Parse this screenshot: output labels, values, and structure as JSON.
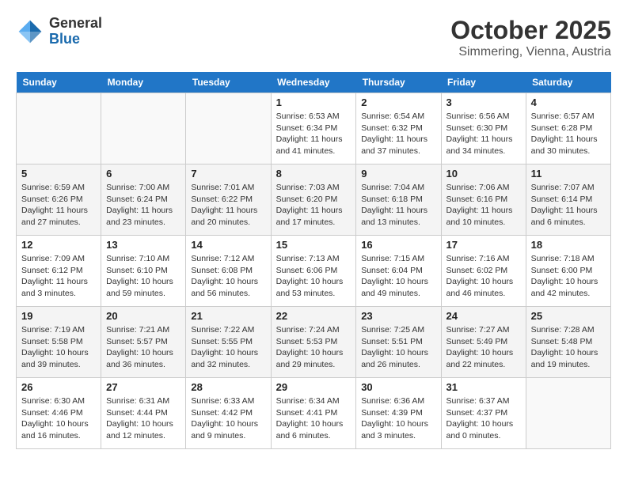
{
  "logo": {
    "general": "General",
    "blue": "Blue"
  },
  "header": {
    "month": "October 2025",
    "location": "Simmering, Vienna, Austria"
  },
  "weekdays": [
    "Sunday",
    "Monday",
    "Tuesday",
    "Wednesday",
    "Thursday",
    "Friday",
    "Saturday"
  ],
  "weeks": [
    [
      {
        "day": "",
        "info": ""
      },
      {
        "day": "",
        "info": ""
      },
      {
        "day": "",
        "info": ""
      },
      {
        "day": "1",
        "info": "Sunrise: 6:53 AM\nSunset: 6:34 PM\nDaylight: 11 hours\nand 41 minutes."
      },
      {
        "day": "2",
        "info": "Sunrise: 6:54 AM\nSunset: 6:32 PM\nDaylight: 11 hours\nand 37 minutes."
      },
      {
        "day": "3",
        "info": "Sunrise: 6:56 AM\nSunset: 6:30 PM\nDaylight: 11 hours\nand 34 minutes."
      },
      {
        "day": "4",
        "info": "Sunrise: 6:57 AM\nSunset: 6:28 PM\nDaylight: 11 hours\nand 30 minutes."
      }
    ],
    [
      {
        "day": "5",
        "info": "Sunrise: 6:59 AM\nSunset: 6:26 PM\nDaylight: 11 hours\nand 27 minutes."
      },
      {
        "day": "6",
        "info": "Sunrise: 7:00 AM\nSunset: 6:24 PM\nDaylight: 11 hours\nand 23 minutes."
      },
      {
        "day": "7",
        "info": "Sunrise: 7:01 AM\nSunset: 6:22 PM\nDaylight: 11 hours\nand 20 minutes."
      },
      {
        "day": "8",
        "info": "Sunrise: 7:03 AM\nSunset: 6:20 PM\nDaylight: 11 hours\nand 17 minutes."
      },
      {
        "day": "9",
        "info": "Sunrise: 7:04 AM\nSunset: 6:18 PM\nDaylight: 11 hours\nand 13 minutes."
      },
      {
        "day": "10",
        "info": "Sunrise: 7:06 AM\nSunset: 6:16 PM\nDaylight: 11 hours\nand 10 minutes."
      },
      {
        "day": "11",
        "info": "Sunrise: 7:07 AM\nSunset: 6:14 PM\nDaylight: 11 hours\nand 6 minutes."
      }
    ],
    [
      {
        "day": "12",
        "info": "Sunrise: 7:09 AM\nSunset: 6:12 PM\nDaylight: 11 hours\nand 3 minutes."
      },
      {
        "day": "13",
        "info": "Sunrise: 7:10 AM\nSunset: 6:10 PM\nDaylight: 10 hours\nand 59 minutes."
      },
      {
        "day": "14",
        "info": "Sunrise: 7:12 AM\nSunset: 6:08 PM\nDaylight: 10 hours\nand 56 minutes."
      },
      {
        "day": "15",
        "info": "Sunrise: 7:13 AM\nSunset: 6:06 PM\nDaylight: 10 hours\nand 53 minutes."
      },
      {
        "day": "16",
        "info": "Sunrise: 7:15 AM\nSunset: 6:04 PM\nDaylight: 10 hours\nand 49 minutes."
      },
      {
        "day": "17",
        "info": "Sunrise: 7:16 AM\nSunset: 6:02 PM\nDaylight: 10 hours\nand 46 minutes."
      },
      {
        "day": "18",
        "info": "Sunrise: 7:18 AM\nSunset: 6:00 PM\nDaylight: 10 hours\nand 42 minutes."
      }
    ],
    [
      {
        "day": "19",
        "info": "Sunrise: 7:19 AM\nSunset: 5:58 PM\nDaylight: 10 hours\nand 39 minutes."
      },
      {
        "day": "20",
        "info": "Sunrise: 7:21 AM\nSunset: 5:57 PM\nDaylight: 10 hours\nand 36 minutes."
      },
      {
        "day": "21",
        "info": "Sunrise: 7:22 AM\nSunset: 5:55 PM\nDaylight: 10 hours\nand 32 minutes."
      },
      {
        "day": "22",
        "info": "Sunrise: 7:24 AM\nSunset: 5:53 PM\nDaylight: 10 hours\nand 29 minutes."
      },
      {
        "day": "23",
        "info": "Sunrise: 7:25 AM\nSunset: 5:51 PM\nDaylight: 10 hours\nand 26 minutes."
      },
      {
        "day": "24",
        "info": "Sunrise: 7:27 AM\nSunset: 5:49 PM\nDaylight: 10 hours\nand 22 minutes."
      },
      {
        "day": "25",
        "info": "Sunrise: 7:28 AM\nSunset: 5:48 PM\nDaylight: 10 hours\nand 19 minutes."
      }
    ],
    [
      {
        "day": "26",
        "info": "Sunrise: 6:30 AM\nSunset: 4:46 PM\nDaylight: 10 hours\nand 16 minutes."
      },
      {
        "day": "27",
        "info": "Sunrise: 6:31 AM\nSunset: 4:44 PM\nDaylight: 10 hours\nand 12 minutes."
      },
      {
        "day": "28",
        "info": "Sunrise: 6:33 AM\nSunset: 4:42 PM\nDaylight: 10 hours\nand 9 minutes."
      },
      {
        "day": "29",
        "info": "Sunrise: 6:34 AM\nSunset: 4:41 PM\nDaylight: 10 hours\nand 6 minutes."
      },
      {
        "day": "30",
        "info": "Sunrise: 6:36 AM\nSunset: 4:39 PM\nDaylight: 10 hours\nand 3 minutes."
      },
      {
        "day": "31",
        "info": "Sunrise: 6:37 AM\nSunset: 4:37 PM\nDaylight: 10 hours\nand 0 minutes."
      },
      {
        "day": "",
        "info": ""
      }
    ]
  ]
}
